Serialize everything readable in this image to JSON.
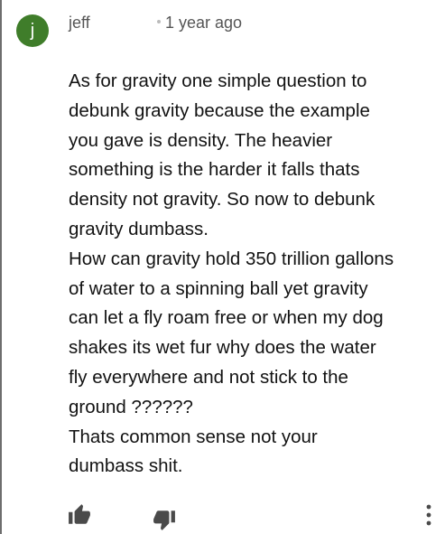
{
  "comment": {
    "author_initial": "j",
    "author_name": "jeff",
    "timestamp": "1 year ago",
    "lines": [
      "As for gravity one simple question to",
      "debunk gravity because the example",
      "you gave is density. The heavier",
      "something is the harder it falls thats",
      "density not gravity. So now to debunk",
      "gravity dumbass.",
      "How can gravity hold 350 trillion gallons",
      "of water to a spinning ball yet gravity",
      "can let a fly roam free or when my dog",
      "shakes its wet fur why does the water",
      "fly everywhere and not stick to the",
      "ground ??????",
      "Thats common sense not your",
      "dumbass shit."
    ]
  },
  "colors": {
    "avatar_bg": "#3f7d2a",
    "text": "#121212",
    "meta_text": "#555555",
    "icon": "#4a4a4a"
  },
  "icons": {
    "like": "thumbs-up-icon",
    "dislike": "thumbs-down-icon",
    "more": "more-vertical-icon"
  }
}
